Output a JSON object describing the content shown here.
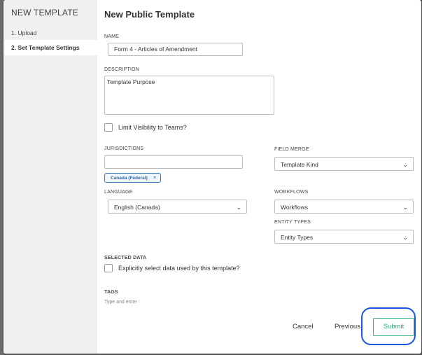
{
  "sidebar": {
    "title": "NEW TEMPLATE",
    "steps": [
      {
        "label": "1. Upload"
      },
      {
        "label": "2. Set Template Settings"
      }
    ]
  },
  "page_title": "New Public Template",
  "name": {
    "label": "NAME",
    "value": "Form 4 - Articles of Amendment"
  },
  "description": {
    "label": "DESCRIPTION",
    "value": "Template Purpose"
  },
  "limit_visibility": {
    "label": "Limit Visibility to Teams?",
    "checked": false
  },
  "jurisdictions": {
    "label": "JURISDICTIONS",
    "value": "",
    "tags": [
      {
        "label": "Canada (Federal)",
        "remove": "×"
      }
    ]
  },
  "field_merge": {
    "label": "FIELD MERGE",
    "value": "Template Kind"
  },
  "language": {
    "label": "LANGUAGE",
    "value": "English (Canada)"
  },
  "workflows": {
    "label": "WORKFLOWS",
    "value": "Workflows"
  },
  "entity_types": {
    "label": "ENTITY TYPES",
    "value": "Entity Types"
  },
  "selected_data": {
    "label": "SELECTED DATA",
    "checkbox_label": "Explicitly select data used by this template?",
    "checked": false
  },
  "tags": {
    "label": "TAGS",
    "placeholder": "Type and enter"
  },
  "footer": {
    "cancel": "Cancel",
    "previous": "Previous",
    "submit": "Submit"
  },
  "chevron_glyph": "⌄",
  "colors": {
    "accent": "#3ab58e",
    "highlight": "#1a56e0",
    "chip": "#3a7fbf"
  }
}
